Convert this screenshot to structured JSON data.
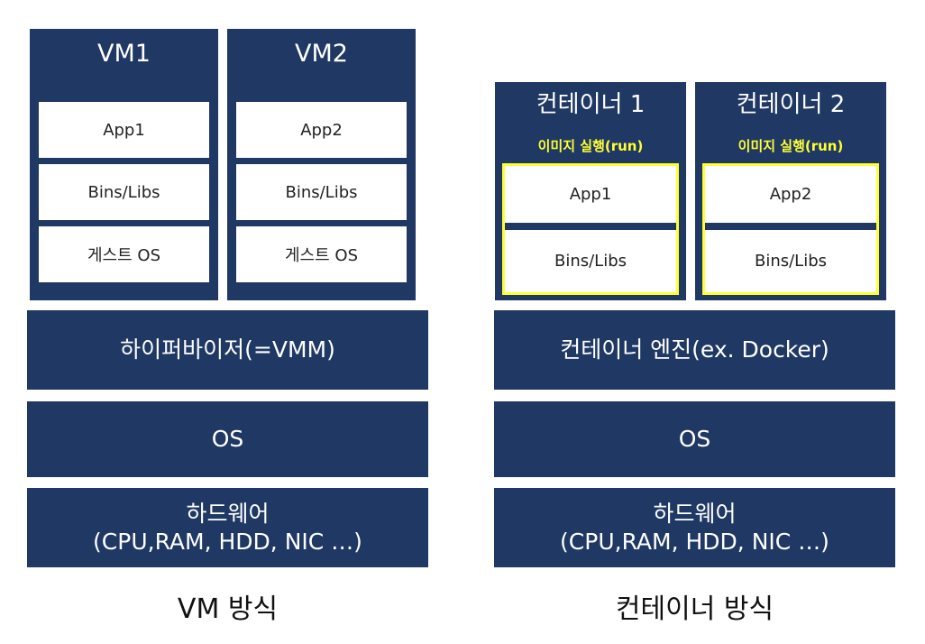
{
  "vm_side": {
    "vm1": {
      "title": "VM1",
      "app": "App1",
      "libs": "Bins/Libs",
      "guest_os": "게스트 OS"
    },
    "vm2": {
      "title": "VM2",
      "app": "App2",
      "libs": "Bins/Libs",
      "guest_os": "게스트 OS"
    },
    "hypervisor": "하이퍼바이저(=VMM)",
    "os": "OS",
    "hardware_title": "하드웨어",
    "hardware_detail": "(CPU,RAM,  HDD, NIC …)",
    "caption": "VM 방식"
  },
  "container_side": {
    "c1": {
      "title": "컨테이너 1",
      "run": "이미지 실행(run)",
      "app": "App1",
      "libs": "Bins/Libs"
    },
    "c2": {
      "title": "컨테이너 2",
      "run": "이미지 실행(run)",
      "app": "App2",
      "libs": "Bins/Libs"
    },
    "engine": "컨테이너 엔진(ex. Docker)",
    "os": "OS",
    "hardware_title": "하드웨어",
    "hardware_detail": "(CPU,RAM,  HDD, NIC …)",
    "caption": "컨테이너 방식"
  },
  "colors": {
    "block": "#1f3864",
    "highlight": "#ffff33",
    "white": "#ffffff"
  }
}
